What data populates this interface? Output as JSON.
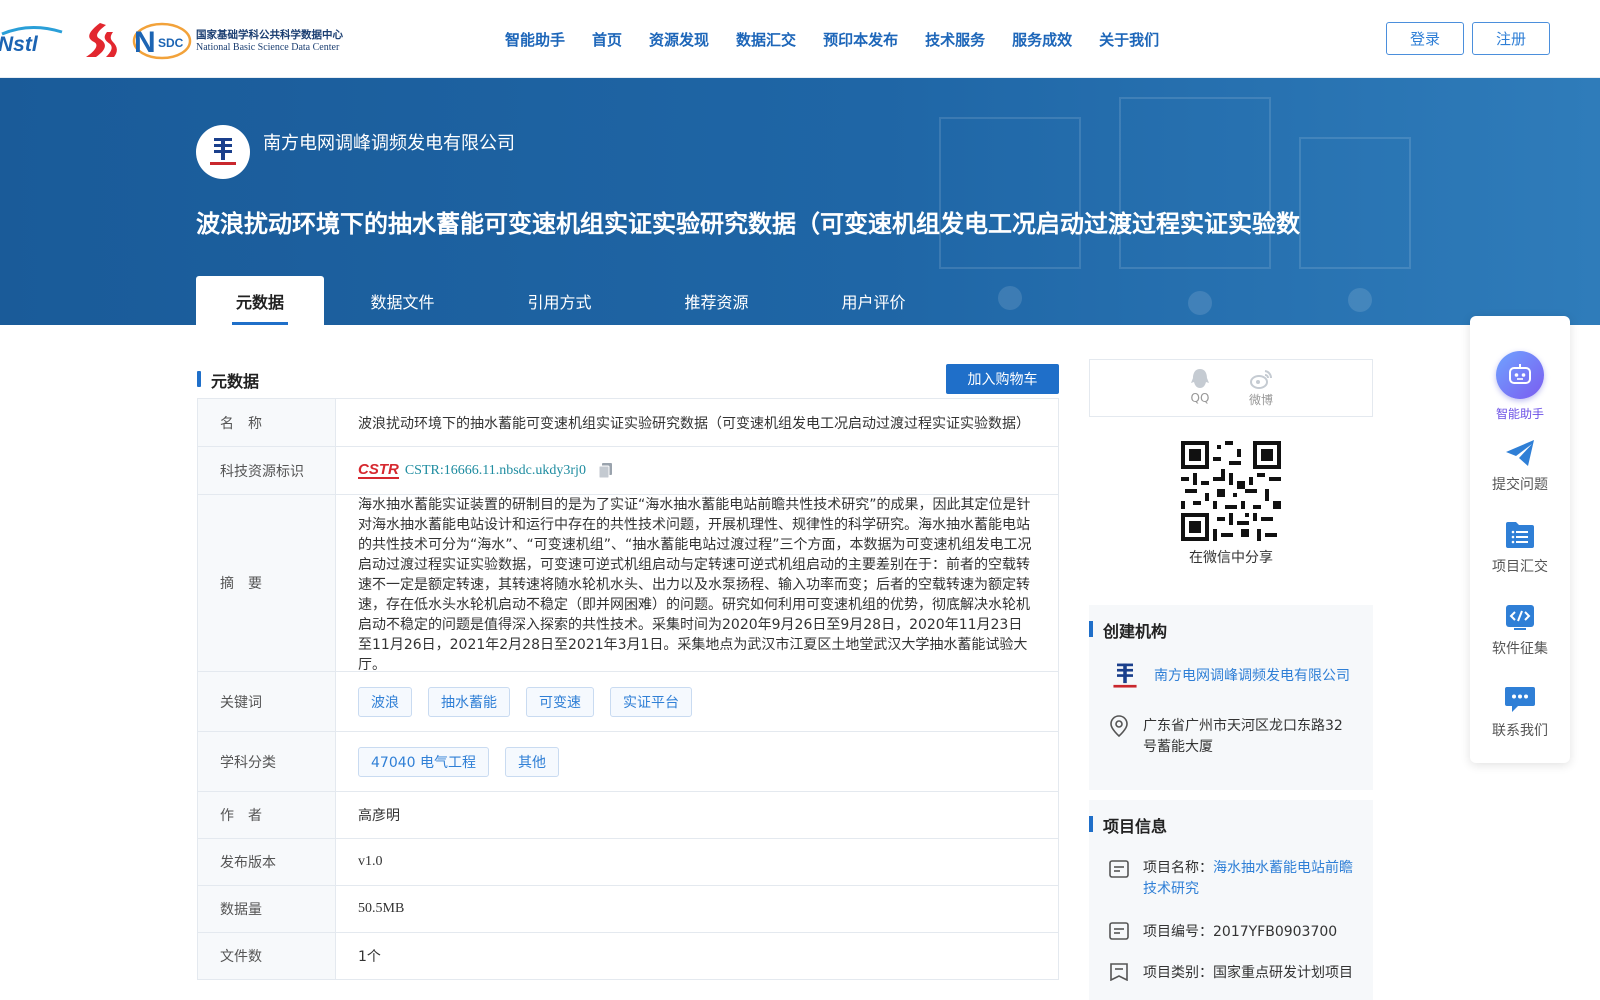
{
  "header": {
    "logos": {
      "nstl": "Nstl",
      "nsdc_cn": "国家基础学科公共科学数据中心",
      "nsdc_en": "National Basic Science Data Center",
      "nsdc_mark": "SDC"
    },
    "nav": [
      "智能助手",
      "首页",
      "资源发现",
      "数据汇交",
      "预印本发布",
      "技术服务",
      "服务成效",
      "关于我们"
    ],
    "login": "登录",
    "register": "注册"
  },
  "banner": {
    "org_name": "南方电网调峰调频发电有限公司",
    "title": "波浪扰动环境下的抽水蓄能可变速机组实证实验研究数据（可变速机组发电工况启动过渡过程实证实验数",
    "tabs": [
      "元数据",
      "数据文件",
      "引用方式",
      "推荐资源",
      "用户评价"
    ]
  },
  "metadata": {
    "section_title": "元数据",
    "cart_button": "加入购物车",
    "labels": {
      "name": "名　称",
      "cstr": "科技资源标识",
      "abstract": "摘　要",
      "keywords": "关键词",
      "subject": "学科分类",
      "author": "作　者",
      "version": "发布版本",
      "size": "数据量",
      "files": "文件数"
    },
    "name": "波浪扰动环境下的抽水蓄能可变速机组实证实验研究数据（可变速机组发电工况启动过渡过程实证实验数据）",
    "cstr_badge": "CSTR",
    "cstr": "CSTR:16666.11.nbsdc.ukdy3rj0",
    "abstract": "海水抽水蓄能实证装置的研制目的是为了实证“海水抽水蓄能电站前瞻共性技术研究”的成果，因此其定位是针对海水抽水蓄能电站设计和运行中存在的共性技术问题，开展机理性、规律性的科学研究。海水抽水蓄能电站的共性技术可分为“海水”、“可变速机组”、“抽水蓄能电站过渡过程”三个方面，本数据为可变速机组发电工况启动过渡过程实证实验数据，可变速可逆式机组启动与定转速可逆式机组启动的主要差别在于：前者的空载转速不一定是额定转速，其转速将随水轮机水头、出力以及水泵扬程、输入功率而变；后者的空载转速为额定转速，存在低水头水轮机启动不稳定（即并网困难）的问题。研究如何利用可变速机组的优势，彻底解决水轮机启动不稳定的问题是值得深入探索的共性技术。采集时间为2020年9月26日至9月28日，2020年11月23日至11月26日，2021年2月28日至2021年3月1日。采集地点为武汉市江夏区土地堂武汉大学抽水蓄能试验大厅。",
    "keywords": [
      "波浪",
      "抽水蓄能",
      "可变速",
      "实证平台"
    ],
    "subjects": [
      "47040 电气工程",
      "其他"
    ],
    "author": "高彦明",
    "version": "v1.0",
    "size": "50.5MB",
    "files": "1个"
  },
  "share": {
    "qq": "QQ",
    "weibo": "微博",
    "qr_caption": "在微信中分享"
  },
  "creator": {
    "title": "创建机构",
    "org": "南方电网调峰调频发电有限公司",
    "address": "广东省广州市天河区龙口东路32号蓄能大厦"
  },
  "project": {
    "title": "项目信息",
    "name_label": "项目名称：",
    "name_value": "海水抽水蓄能电站前瞻技术研究",
    "code": "项目编号：2017YFB0903700",
    "type": "项目类别：国家重点研发计划项目"
  },
  "float_bar": [
    "智能助手",
    "提交问题",
    "项目汇交",
    "软件征集",
    "联系我们"
  ],
  "colors": {
    "primary": "#1f6fc9",
    "banner": "#1f66a6",
    "link": "#2f7fd6",
    "float_active": "#7b5cf0"
  }
}
